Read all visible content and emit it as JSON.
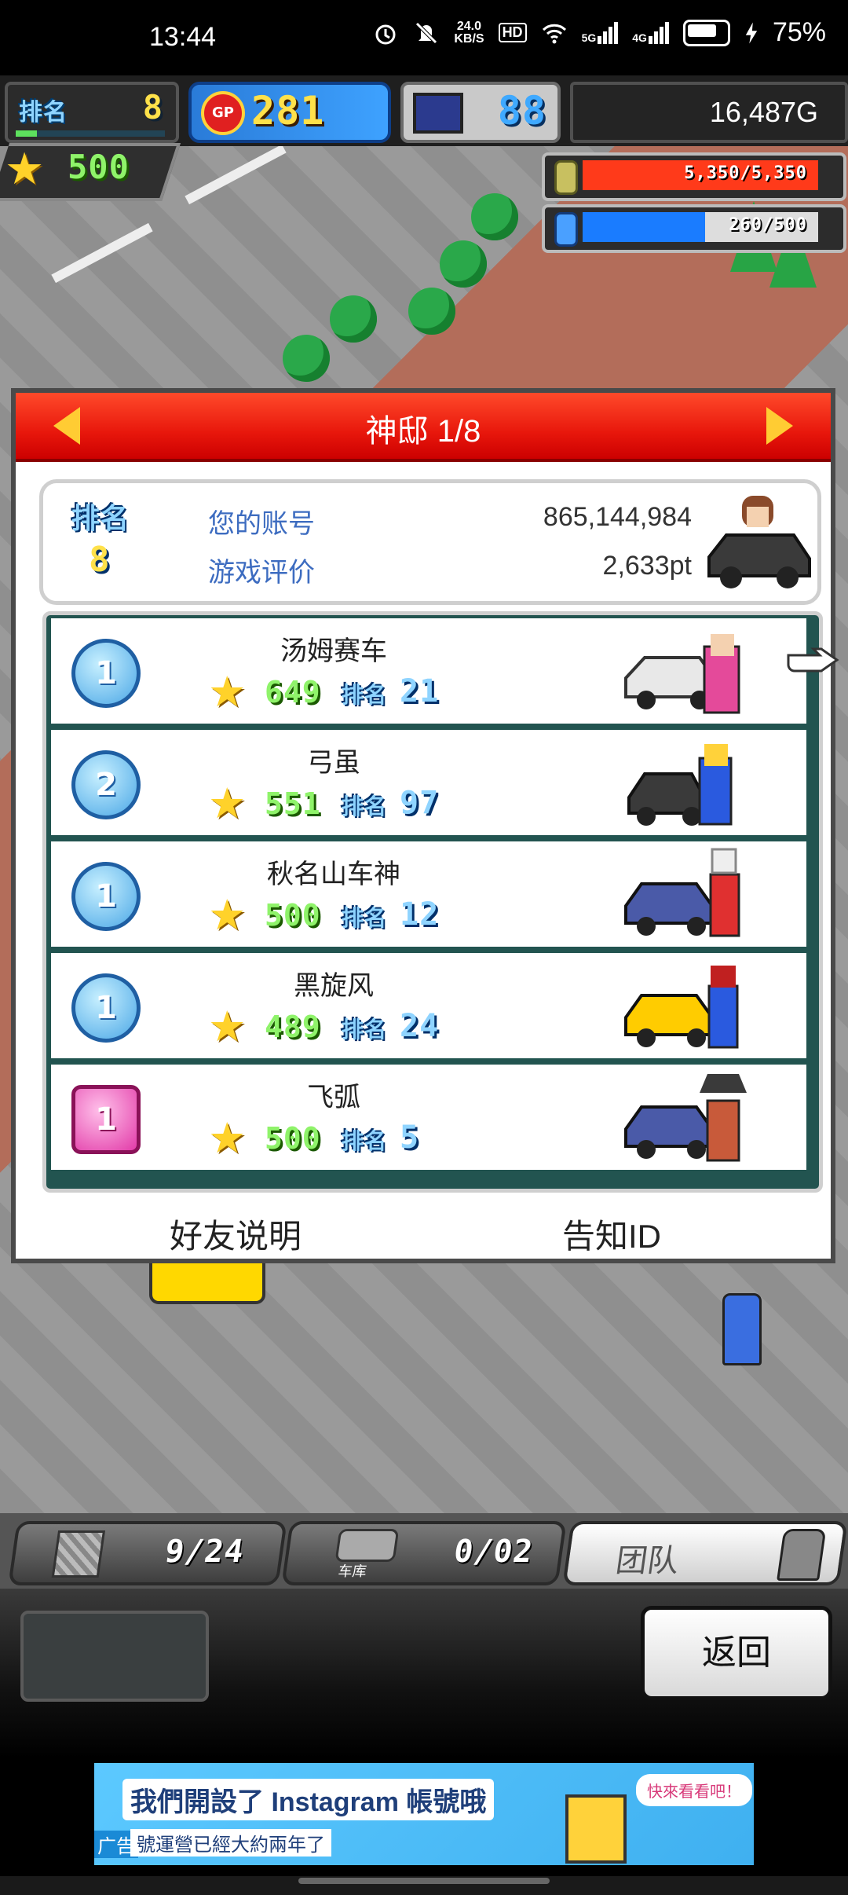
{
  "status_bar": {
    "time": "13:44",
    "net_speed_value": "24.0",
    "net_speed_unit": "KB/S",
    "hd_label": "HD",
    "signal_1": "5G",
    "signal_2": "4G",
    "battery_pct": "75%"
  },
  "hud": {
    "rank_label": "排名",
    "rank_value": "8",
    "rank_progress": 0.14,
    "gp_label": "GP",
    "gp_value": "281",
    "pc_value": "88",
    "money": "16,487G",
    "stars": "500",
    "coin_bar": {
      "text": "5,350/5,350",
      "fill": 1.0,
      "color": "#ff3a1a"
    },
    "mana_bar": {
      "text": "260/500",
      "fill": 0.52,
      "color": "#1a7cff"
    }
  },
  "dialog": {
    "title": "神邸 1/8",
    "account": {
      "rank_label": "排名",
      "rank_value": "8",
      "account_label": "您的账号",
      "account_value": "865,144,984",
      "rating_label": "游戏评价",
      "rating_value": "2,633pt"
    },
    "friends": [
      {
        "badge": "1",
        "name": "汤姆赛车",
        "score": "649",
        "rank_label": "排名",
        "rank": "21",
        "badge_style": "blue"
      },
      {
        "badge": "2",
        "name": "弓虽",
        "score": "551",
        "rank_label": "排名",
        "rank": "97",
        "badge_style": "blue"
      },
      {
        "badge": "1",
        "name": "秋名山车神",
        "score": "500",
        "rank_label": "排名",
        "rank": "12",
        "badge_style": "blue"
      },
      {
        "badge": "1",
        "name": "黑旋风",
        "score": "489",
        "rank_label": "排名",
        "rank": "24",
        "badge_style": "blue"
      },
      {
        "badge": "1",
        "name": "飞弧",
        "score": "500",
        "rank_label": "排名",
        "rank": "5",
        "badge_style": "pink"
      }
    ],
    "footer_left": "好友说明",
    "footer_right": "告知ID"
  },
  "bottom_tabs": {
    "parts_count": "9/24",
    "garage_label": "车库",
    "garage_count": "0/02",
    "team_label": "团队"
  },
  "bottom_panel": {
    "back_label": "返回"
  },
  "ad": {
    "tag": "广告",
    "main": "我們開設了 Instagram 帳號哦",
    "sub": "號運營已經大約兩年了",
    "bubble": "快來看看吧！"
  }
}
